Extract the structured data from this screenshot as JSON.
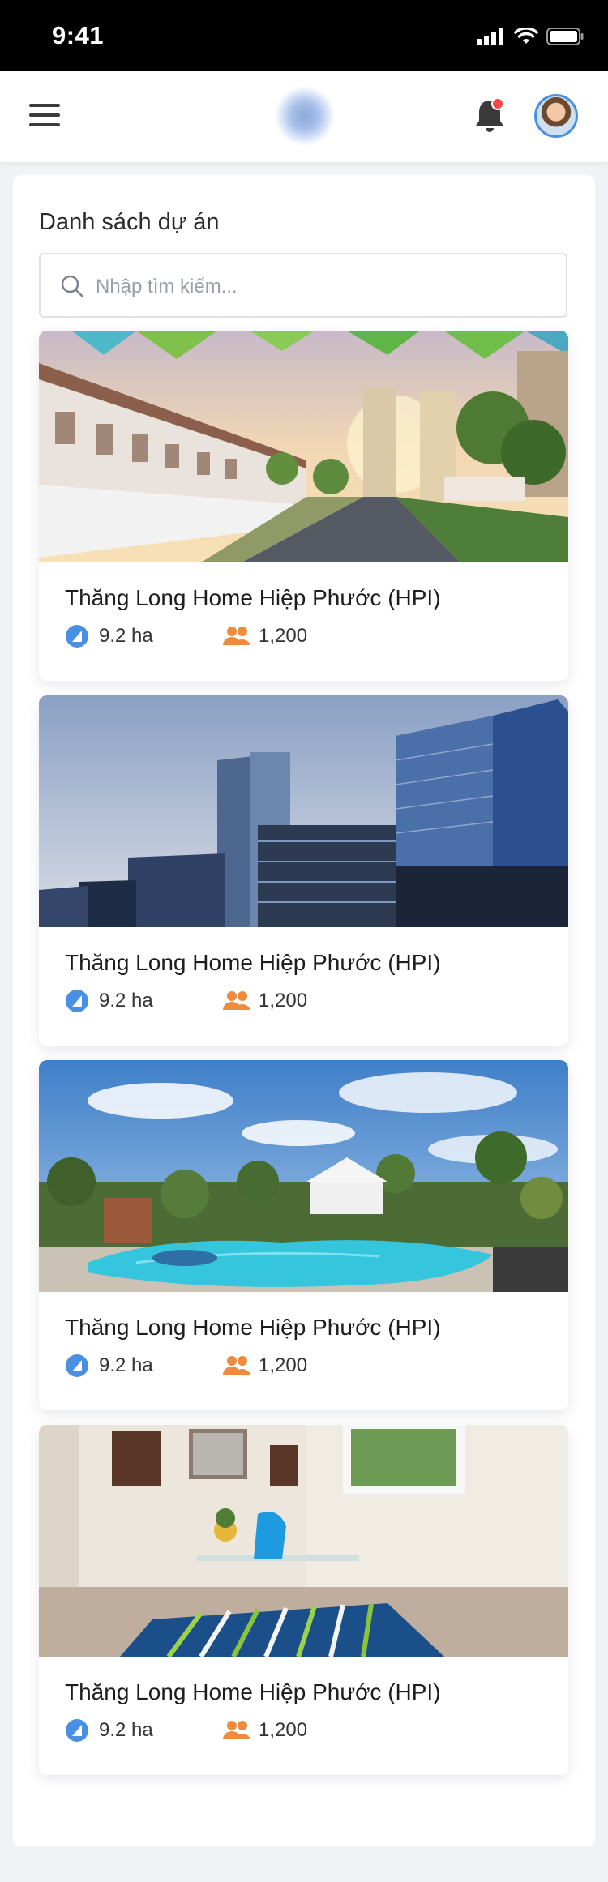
{
  "status_bar": {
    "time": "9:41"
  },
  "header": {
    "menu_icon": "hamburger-menu-icon",
    "logo": "app-logo",
    "notification_icon": "bell-icon",
    "notification_dot_color": "#f04848",
    "avatar": "user-avatar",
    "accent": "#4a90e2"
  },
  "main": {
    "title": "Danh sách dự án",
    "search": {
      "placeholder": "Nhập tìm kiếm..."
    }
  },
  "projects": [
    {
      "name": "Thăng Long Home Hiệp Phước (HPI)",
      "area": "9.2 ha",
      "residents": "1,200",
      "image": "villa-townhouse-street"
    },
    {
      "name": "Thăng Long Home Hiệp Phước (HPI)",
      "area": "9.2 ha",
      "residents": "1,200",
      "image": "city-skyscrapers"
    },
    {
      "name": "Thăng Long Home Hiệp Phước (HPI)",
      "area": "9.2 ha",
      "residents": "1,200",
      "image": "swimming-pool-garden"
    },
    {
      "name": "Thăng Long Home Hiệp Phước (HPI)",
      "area": "9.2 ha",
      "residents": "1,200",
      "image": "interior-room-chair"
    }
  ],
  "icons": {
    "area": "area-icon",
    "people": "people-icon",
    "area_color": "#4a90e2",
    "people_color": "#f08a3c"
  }
}
